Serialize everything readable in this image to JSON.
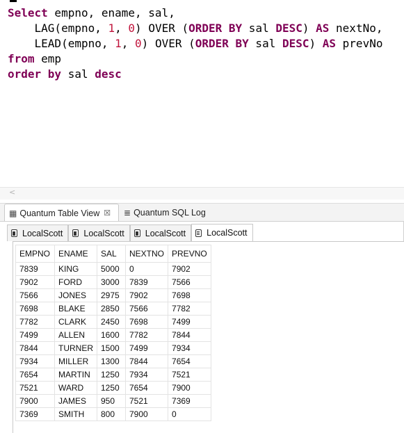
{
  "editor": {
    "lines": [
      [
        {
          "t": "Select",
          "c": "kw"
        },
        {
          "t": " empno, ename, sal,",
          "c": "pl"
        }
      ],
      [
        {
          "t": "    LAG(empno, ",
          "c": "pl"
        },
        {
          "t": "1",
          "c": "num"
        },
        {
          "t": ", ",
          "c": "pl"
        },
        {
          "t": "0",
          "c": "num"
        },
        {
          "t": ") OVER (",
          "c": "pl"
        },
        {
          "t": "ORDER BY",
          "c": "kw"
        },
        {
          "t": " sal ",
          "c": "pl"
        },
        {
          "t": "DESC",
          "c": "kw"
        },
        {
          "t": ") ",
          "c": "pl"
        },
        {
          "t": "AS",
          "c": "kw"
        },
        {
          "t": " nextNo,",
          "c": "pl"
        }
      ],
      [
        {
          "t": "    LEAD(empno, ",
          "c": "pl"
        },
        {
          "t": "1",
          "c": "num"
        },
        {
          "t": ", ",
          "c": "pl"
        },
        {
          "t": "0",
          "c": "num"
        },
        {
          "t": ") OVER (",
          "c": "pl"
        },
        {
          "t": "ORDER BY",
          "c": "kw"
        },
        {
          "t": " sal ",
          "c": "pl"
        },
        {
          "t": "DESC",
          "c": "kw"
        },
        {
          "t": ") ",
          "c": "pl"
        },
        {
          "t": "AS",
          "c": "kw"
        },
        {
          "t": " prevNo",
          "c": "pl"
        }
      ],
      [
        {
          "t": "from",
          "c": "kw"
        },
        {
          "t": " emp",
          "c": "pl"
        }
      ],
      [
        {
          "t": "order by",
          "c": "kw"
        },
        {
          "t": " sal ",
          "c": "pl"
        },
        {
          "t": "desc",
          "c": "kw"
        }
      ]
    ],
    "scroll_arrow": "<"
  },
  "view_tabs": [
    {
      "label": "Quantum Table View",
      "icon": "table-icon",
      "glyph": "▦",
      "active": true,
      "close": "☒"
    },
    {
      "label": "Quantum SQL Log",
      "icon": "list-icon",
      "glyph": "≣",
      "active": false
    }
  ],
  "connection_tabs": [
    {
      "label": "LocalScott",
      "active": false
    },
    {
      "label": "LocalScott",
      "active": false
    },
    {
      "label": "LocalScott",
      "active": false
    },
    {
      "label": "LocalScott",
      "active": true
    }
  ],
  "results": {
    "columns": [
      "EMPNO",
      "ENAME",
      "SAL",
      "NEXTNO",
      "PREVNO"
    ],
    "rows": [
      [
        "7839",
        "KING",
        "5000",
        "0",
        "7902"
      ],
      [
        "7902",
        "FORD",
        "3000",
        "7839",
        "7566"
      ],
      [
        "7566",
        "JONES",
        "2975",
        "7902",
        "7698"
      ],
      [
        "7698",
        "BLAKE",
        "2850",
        "7566",
        "7782"
      ],
      [
        "7782",
        "CLARK",
        "2450",
        "7698",
        "7499"
      ],
      [
        "7499",
        "ALLEN",
        "1600",
        "7782",
        "7844"
      ],
      [
        "7844",
        "TURNER",
        "1500",
        "7499",
        "7934"
      ],
      [
        "7934",
        "MILLER",
        "1300",
        "7844",
        "7654"
      ],
      [
        "7654",
        "MARTIN",
        "1250",
        "7934",
        "7521"
      ],
      [
        "7521",
        "WARD",
        "1250",
        "7654",
        "7900"
      ],
      [
        "7900",
        "JAMES",
        "950",
        "7521",
        "7369"
      ],
      [
        "7369",
        "SMITH",
        "800",
        "7900",
        "0"
      ]
    ]
  },
  "colors": {
    "keyword": "#7f0055",
    "number": "#c0143c"
  }
}
